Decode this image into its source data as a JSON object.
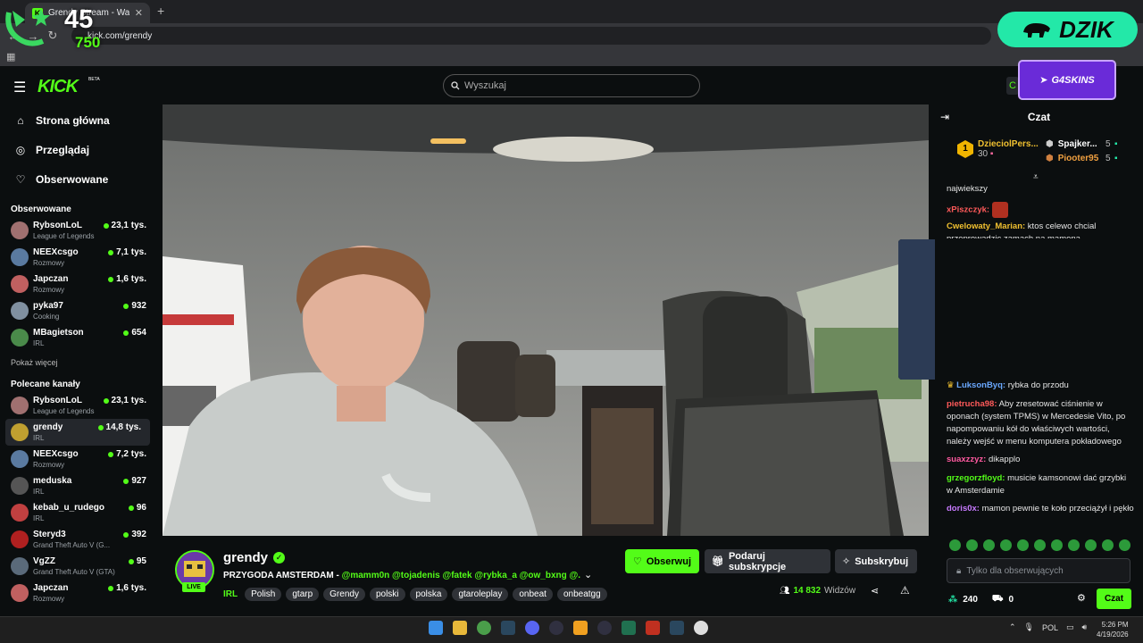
{
  "browser": {
    "tab_title": "Grendy Stream - Watch Live",
    "url": "kick.com/grendy"
  },
  "overlay": {
    "counter_main": "45",
    "counter_sub": "750",
    "dzik_label": "DZIK",
    "g4s_label": "G4SKINS"
  },
  "header": {
    "logo": "KICK",
    "beta": "BETA",
    "search_placeholder": "Wyszukaj"
  },
  "sidebar": {
    "nav": [
      {
        "label": "Strona główna",
        "icon": "home-icon"
      },
      {
        "label": "Przeglądaj",
        "icon": "compass-icon"
      },
      {
        "label": "Obserwowane",
        "icon": "heart-icon"
      }
    ],
    "followed_title": "Obserwowane",
    "followed": [
      {
        "name": "RybsonLoL",
        "category": "League of Legends",
        "viewers": "23,1 tys.",
        "color": "#a07070"
      },
      {
        "name": "NEEXcsgo",
        "category": "Rozmowy",
        "viewers": "7,1 tys.",
        "color": "#5a7aa0"
      },
      {
        "name": "Japczan",
        "category": "Rozmowy",
        "viewers": "1,6 tys.",
        "color": "#c06060"
      },
      {
        "name": "pyka97",
        "category": "Cooking",
        "viewers": "932",
        "color": "#8090a0"
      },
      {
        "name": "MBagietson",
        "category": "IRL",
        "viewers": "654",
        "color": "#4a8a4a"
      }
    ],
    "show_more": "Pokaż więcej",
    "recommended_title": "Polecane kanały",
    "recommended": [
      {
        "name": "RybsonLoL",
        "category": "League of Legends",
        "viewers": "23,1 tys.",
        "color": "#a07070"
      },
      {
        "name": "grendy",
        "category": "IRL",
        "viewers": "14,8 tys.",
        "color": "#c0a030"
      },
      {
        "name": "NEEXcsgo",
        "category": "Rozmowy",
        "viewers": "7,2 tys.",
        "color": "#5a7aa0"
      },
      {
        "name": "meduska",
        "category": "IRL",
        "viewers": "927",
        "color": "#555555"
      },
      {
        "name": "kebab_u_rudego",
        "category": "IRL",
        "viewers": "96",
        "color": "#c04040"
      },
      {
        "name": "Steryd3",
        "category": "Grand Theft Auto V (G...",
        "viewers": "392",
        "color": "#b02020"
      },
      {
        "name": "VgZZ",
        "category": "Grand Theft Auto V (GTA)",
        "viewers": "95",
        "color": "#5a6a7a"
      },
      {
        "name": "Japczan",
        "category": "Rozmowy",
        "viewers": "1,6 tys.",
        "color": "#c06060"
      }
    ]
  },
  "stream": {
    "name": "grendy",
    "live": "LIVE",
    "title_plain": "PRZYGODA AMSTERDAM - ",
    "title_mentions": "@mamm0n @tojadenis @fatek @rybka_a @ow_bxng @...",
    "category": "IRL",
    "tags": [
      "Polish",
      "gtarp",
      "Grendy",
      "polski",
      "polska",
      "gtaroleplay",
      "onbeat",
      "onbeatgg"
    ],
    "follow": "Obserwuj",
    "gift": "Podaruj subskrypcje",
    "subscribe": "Subskrybuj",
    "viewers_count": "14 832",
    "viewers_label": "Widzów"
  },
  "chat": {
    "title": "Czat",
    "leaderboard": {
      "top_name": "DzieciolPers...",
      "top_rank": "1",
      "top_value": "30",
      "second_name": "Spajker...",
      "second_value": "5",
      "third_name": "Piooter95",
      "third_value": "5"
    },
    "messages_top": [
      {
        "user": "",
        "user_color": "#ffffff",
        "text": "najwiekszy"
      },
      {
        "user": "xPiszczyk:",
        "user_color": "#ff5a5a",
        "text": ""
      },
      {
        "user": "Cwelowaty_Marian:",
        "user_color": "#f0c030",
        "text": " ktos celewo chcial przeprowadzic zamach na mamona"
      }
    ],
    "messages": [
      {
        "user": "LuksonByq:",
        "user_color": "#6aa8ff",
        "text": " rybka do przodu"
      },
      {
        "user": "pietrucha98:",
        "user_color": "#ff5a5a",
        "text": " Aby zresetować ciśnienie w oponach (system TPMS) w Mercedesie Vito, po napompowaniu kół do właściwych wartości, należy wejść w menu komputera pokładowego"
      },
      {
        "user": "suaxzzyz:",
        "user_color": "#ff5aa0",
        "text": " dikapplo"
      },
      {
        "user": "grzegorzfloyd:",
        "user_color": "#53fc18",
        "text": " musicie kamsonowi dać grzybki w Amsterdamie"
      },
      {
        "user": "doris0x:",
        "user_color": "#c87aff",
        "text": " mamon pewnie te koło przeciążył i pękło"
      }
    ],
    "input_placeholder": "Tylko dla obserwujących",
    "points": "240",
    "gifts": "0",
    "send": "Czat"
  },
  "taskbar": {
    "lang": "POL",
    "time": "5:26 PM",
    "date": "4/19/2026"
  }
}
